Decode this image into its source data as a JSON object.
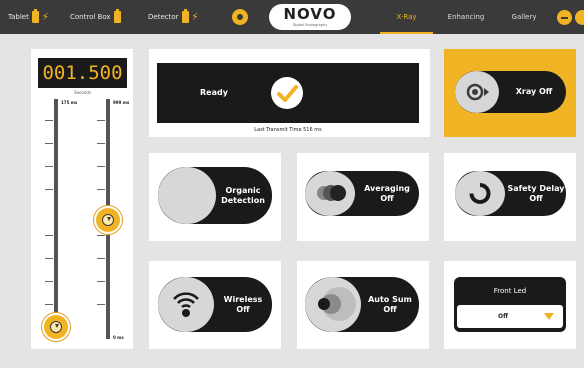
{
  "topbar": {
    "tablet_label": "Tablet",
    "controlbox_label": "Control Box",
    "detector_label": "Detector",
    "logo_name": "NOVO",
    "logo_sub": "Digital Radiography",
    "tabs": [
      {
        "label": "X-Ray",
        "active": true
      },
      {
        "label": "Enhancing",
        "active": false
      },
      {
        "label": "Gallery",
        "active": false
      }
    ]
  },
  "slider": {
    "readout": "001.500",
    "unit": "Seconds",
    "left_top_label": "175 ms",
    "right_top_label": "999 ms",
    "right_bottom_label": "0 ms"
  },
  "status": {
    "ready_label": "Ready",
    "transmit_text": "Last Transmit Time 516 ms"
  },
  "toggles": {
    "xray": "Xray Off",
    "organic": "Organic Detection",
    "averaging": "Averaging Off",
    "safety": "Safety Delay Off",
    "wireless": "Wireless Off",
    "autosum": "Auto Sum Off"
  },
  "front_led": {
    "title": "Front Led",
    "value": "Off"
  },
  "colors": {
    "accent": "#f0b323",
    "topbar": "#3a3a3a",
    "panel_dark": "#1a1a1a",
    "background": "#e4e4e4"
  }
}
